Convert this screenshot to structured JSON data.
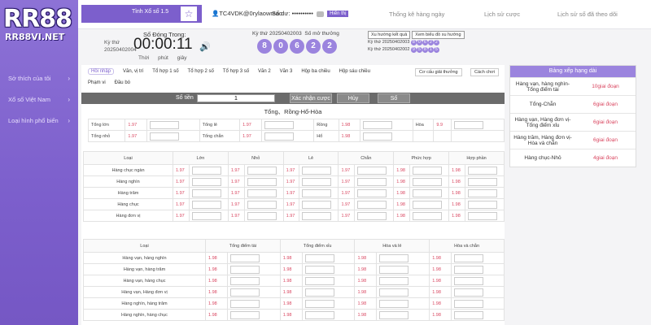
{
  "brand": {
    "logo": "RR88",
    "site": "RR88VI.NET"
  },
  "header": {
    "game_title": "Tỉnh Xổ số 1.5",
    "username": "TC4VDK@0rylaowmao",
    "balance_label": "Số dư:",
    "balance_value": "••••••••••",
    "show_label": "Hiển thị",
    "nav": [
      "Thống kê hàng ngày",
      "Lịch sử cược",
      "Lịch sử số đã theo dõi"
    ]
  },
  "sidebar": {
    "items": [
      "Sở thích của tôi",
      "Xổ số Việt Nam",
      "Loại hình phổ biến"
    ]
  },
  "round": {
    "label": "Kỳ thứ",
    "id": "20250402004",
    "countdown_title": "Số Đóng Trong:",
    "countdown": "00:00:11",
    "units": [
      "Thời",
      "phút",
      "giây"
    ]
  },
  "result": {
    "label": "Kỳ thứ 20250402003",
    "label2": "Số mở thưởng",
    "balls": [
      "8",
      "0",
      "6",
      "2",
      "2"
    ],
    "buttons": [
      "Xu hướng kết quả",
      "Xem biểu đồ xu hướng"
    ],
    "history": [
      {
        "id": "Kỳ thứ 20250402003",
        "balls": [
          "8",
          "0",
          "6",
          "2",
          "2"
        ]
      },
      {
        "id": "Kỳ thứ 20250402002",
        "balls": [
          "9",
          "5",
          "8",
          "1",
          "5"
        ]
      }
    ]
  },
  "tabs": [
    "Hồi nhập",
    "Văn, vị trí",
    "Tổ hợp 1 số",
    "Tổ hợp 2 số",
    "Tổ hợp 3 số",
    "Văn 2",
    "Văn 3",
    "Hộp ba chiều",
    "Hộp sáu chiều",
    "Phạm vi",
    "Đầu bó"
  ],
  "tips": [
    "Cơ cấu giải thưởng",
    "Cách chơi"
  ],
  "amount": {
    "label": "Số tiền",
    "value": "1",
    "confirm": "Xác nhận cược",
    "cancel": "Hủy",
    "number": "Số"
  },
  "section_title": "Tổng、Rồng-Hổ-Hòa",
  "summary": {
    "row1": [
      [
        "Tổng lớn",
        "1.97"
      ],
      [
        "Tổng lẻ",
        "1.97"
      ],
      [
        "Rồng",
        "1.98"
      ],
      [
        "Hòa",
        "9.9"
      ]
    ],
    "row2": [
      [
        "Tổng nhỏ",
        "1.97"
      ],
      [
        "Tổng chẵn",
        "1.97"
      ],
      [
        "Hổ",
        "1.98"
      ]
    ]
  },
  "grid": {
    "head": [
      "Loại",
      "Lớn",
      "Nhỏ",
      "Lẻ",
      "Chẵn",
      "Phức hợp",
      "Hợp phần"
    ],
    "rows": [
      {
        "name": "Hàng chục ngàn",
        "odds": [
          "1.97",
          "1.97",
          "1.97",
          "1.97",
          "1.98",
          "1.98"
        ]
      },
      {
        "name": "Hàng nghìn",
        "odds": [
          "1.97",
          "1.97",
          "1.97",
          "1.97",
          "1.98",
          "1.98"
        ]
      },
      {
        "name": "Hàng trăm",
        "odds": [
          "1.97",
          "1.97",
          "1.97",
          "1.97",
          "1.98",
          "1.98"
        ]
      },
      {
        "name": "Hàng chục",
        "odds": [
          "1.97",
          "1.97",
          "1.97",
          "1.97",
          "1.98",
          "1.98"
        ]
      },
      {
        "name": "Hàng đơn vị",
        "odds": [
          "1.97",
          "1.97",
          "1.97",
          "1.97",
          "1.98",
          "1.98"
        ]
      }
    ]
  },
  "grid2": {
    "head": [
      "Loại",
      "Tổng điểm tài",
      "Tổng điểm xỉu",
      "Hòa và lẻ",
      "Hòa và chẵn"
    ],
    "rows": [
      {
        "name": "Hàng vạn, hàng nghìn",
        "odds": [
          "1.98",
          "1.98",
          "1.98",
          "1.98"
        ]
      },
      {
        "name": "Hàng vạn, hàng trăm",
        "odds": [
          "1.98",
          "1.98",
          "1.98",
          "1.98"
        ]
      },
      {
        "name": "Hàng vạn, hàng chục",
        "odds": [
          "1.98",
          "1.98",
          "1.98",
          "1.98"
        ]
      },
      {
        "name": "Hàng vạn, Hàng đơn vị",
        "odds": [
          "1.98",
          "1.98",
          "1.98",
          "1.98"
        ]
      },
      {
        "name": "Hàng nghìn, hàng trăm",
        "odds": [
          "1.98",
          "1.98",
          "1.98",
          "1.98"
        ]
      },
      {
        "name": "Hàng nghìn, hàng chục",
        "odds": [
          "1.98",
          "1.98",
          "1.98",
          "1.98"
        ]
      }
    ]
  },
  "ranking": {
    "title": "Bảng xếp hạng dài",
    "rows": [
      {
        "name": "Hàng vạn, hàng nghìn-Tổng điểm tài",
        "value": "10giai đoạn"
      },
      {
        "name": "Tổng-Chẵn",
        "value": "6giai đoạn"
      },
      {
        "name": "Hàng vạn, Hàng đơn vị-Tổng điểm xỉu",
        "value": "6giai đoạn"
      },
      {
        "name": "Hàng trăm, Hàng đơn vị-Hòa và chẵn",
        "value": "6giai đoạn"
      },
      {
        "name": "Hàng chục-Nhỏ",
        "value": "4giai đoạn"
      }
    ]
  },
  "colors": {
    "accent": "#7c5fcc",
    "odds": "#d9455f",
    "ball": "#9b84de"
  }
}
